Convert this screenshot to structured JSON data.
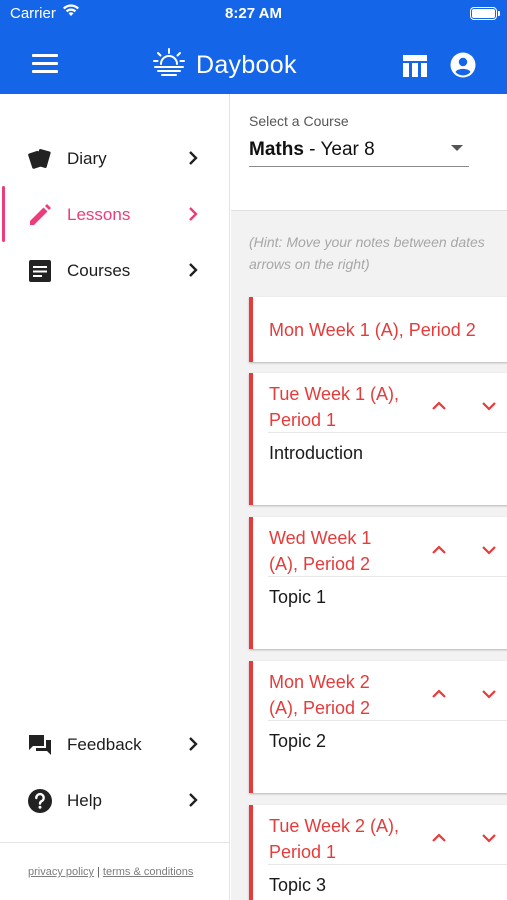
{
  "status_bar": {
    "carrier": "Carrier",
    "time": "8:27 AM"
  },
  "header": {
    "title": "Daybook",
    "accent_color": "#1565e8",
    "icons": [
      "menu-icon",
      "sun-logo-icon",
      "table-icon",
      "account-circle-icon"
    ]
  },
  "sidebar": {
    "items": [
      {
        "label": "Diary",
        "icon": "cards-icon"
      },
      {
        "label": "Lessons",
        "icon": "pencil-icon",
        "active": true
      },
      {
        "label": "Courses",
        "icon": "document-icon"
      }
    ],
    "bottom_items": [
      {
        "label": "Feedback",
        "icon": "chat-icon"
      },
      {
        "label": "Help",
        "icon": "help-circle-icon"
      }
    ],
    "footer": {
      "privacy": "privacy policy",
      "separator": "|",
      "terms": "terms & conditions"
    },
    "active_color": "#ec3d7a"
  },
  "course_select": {
    "label": "Select a Course",
    "subject": "Maths",
    "rest": " - Year 8"
  },
  "hint": {
    "line1": "(Hint: Move your notes between dates",
    "line2": "arrows on the right)"
  },
  "lessons": [
    {
      "line1": "Mon Week 1 (A), Period 2",
      "line2": "",
      "note": ""
    },
    {
      "line1": "Tue Week 1 (A),",
      "line2": "Period 1",
      "note": "Introduction"
    },
    {
      "line1": "Wed Week 1",
      "line2": "(A), Period 2",
      "note": "Topic 1"
    },
    {
      "line1": "Mon Week 2",
      "line2": "(A), Period 2",
      "note": "Topic 2"
    },
    {
      "line1": "Tue Week 2 (A),",
      "line2": "Period 1",
      "note": "Topic 3"
    }
  ],
  "lesson_accent_color": "#e53b3b"
}
